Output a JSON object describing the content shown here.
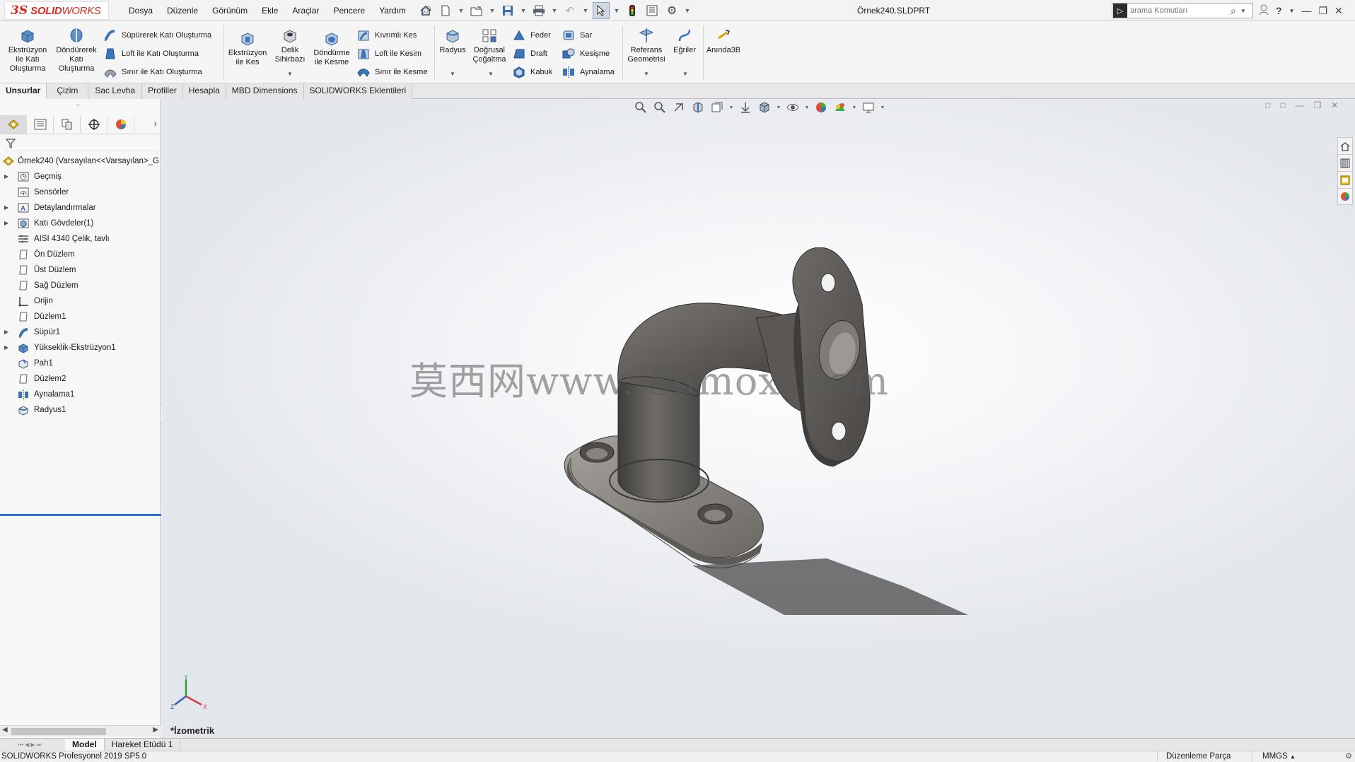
{
  "app": {
    "brand_ds": "3S",
    "brand_solid": "SOLID",
    "brand_works": "WORKS",
    "document_title": "Örnek240.SLDPRT"
  },
  "menu": [
    "Dosya",
    "Düzenle",
    "Görünüm",
    "Ekle",
    "Araçlar",
    "Pencere",
    "Yardım"
  ],
  "search": {
    "placeholder": "arama Komutları"
  },
  "ribbon": {
    "extrude_boss": [
      "Ekstrüzyon",
      "ile Katı",
      "Oluşturma"
    ],
    "revolve_boss": [
      "Döndürerek",
      "Katı",
      "Oluşturma"
    ],
    "sweep_boss": "Süpürerek Katı Oluşturma",
    "loft_boss": "Loft ile Katı Oluşturma",
    "boundary_boss": "Sınır ile Katı Oluşturma",
    "extrude_cut": [
      "Ekstrüzyon",
      "ile Kes"
    ],
    "hole_wizard": [
      "Delik",
      "Sihirbazı"
    ],
    "revolve_cut": [
      "Döndürme",
      "ile Kesme"
    ],
    "swept_cut": "Kıvrımlı Kes",
    "loft_cut": "Loft ile Kesim",
    "boundary_cut": "Sınır ile Kesme",
    "fillet": "Radyus",
    "linear_pattern": [
      "Doğrusal",
      "Çoğaltma"
    ],
    "rib": "Feder",
    "draft": "Draft",
    "shell": "Kabuk",
    "wrap": "Sar",
    "intersect": "Kesişme",
    "mirror": "Aynalama",
    "ref_geometry": [
      "Referans",
      "Geometrisi"
    ],
    "curves": "Eğriler",
    "instant3d": "Anında3B"
  },
  "tabs": [
    {
      "label": "Unsurlar",
      "active": true
    },
    {
      "label": "Çizim",
      "active": false
    },
    {
      "label": "Sac Levha",
      "active": false
    },
    {
      "label": "Profiller",
      "active": false
    },
    {
      "label": "Hesapla",
      "active": false
    },
    {
      "label": "MBD Dimensions",
      "active": false
    },
    {
      "label": "SOLIDWORKS Eklentileri",
      "active": false
    }
  ],
  "tree": {
    "root": "Örnek240  (Varsayılan<<Varsayılan>_G",
    "items": [
      {
        "label": "Geçmiş",
        "expandable": true,
        "icon": "history-icon"
      },
      {
        "label": "Sensörler",
        "expandable": false,
        "icon": "sensor-icon"
      },
      {
        "label": "Detaylandırmalar",
        "expandable": true,
        "icon": "annotation-icon"
      },
      {
        "label": "Katı Gövdeler(1)",
        "expandable": true,
        "icon": "solid-bodies-icon"
      },
      {
        "label": "AISI 4340 Çelik, tavlı",
        "expandable": false,
        "icon": "material-icon"
      },
      {
        "label": "Ön Düzlem",
        "expandable": false,
        "icon": "plane-icon"
      },
      {
        "label": "Üst Düzlem",
        "expandable": false,
        "icon": "plane-icon"
      },
      {
        "label": "Sağ Düzlem",
        "expandable": false,
        "icon": "plane-icon"
      },
      {
        "label": "Orijin",
        "expandable": false,
        "icon": "origin-icon"
      },
      {
        "label": "Düzlem1",
        "expandable": false,
        "icon": "plane-icon"
      },
      {
        "label": "Süpür1",
        "expandable": true,
        "icon": "sweep-icon"
      },
      {
        "label": "Yükseklik-Ekstrüzyon1",
        "expandable": true,
        "icon": "extrude-icon"
      },
      {
        "label": "Pah1",
        "expandable": false,
        "icon": "chamfer-icon"
      },
      {
        "label": "Düzlem2",
        "expandable": false,
        "icon": "plane-icon"
      },
      {
        "label": "Aynalama1",
        "expandable": false,
        "icon": "mirror-icon"
      },
      {
        "label": "Radyus1",
        "expandable": false,
        "icon": "fillet-icon"
      }
    ]
  },
  "viewport": {
    "view_name": "*İzometrik",
    "watermark": "莫西网www. 3dmox. com",
    "triad_x": "X",
    "triad_y": "Y",
    "triad_z": "Z"
  },
  "bottom_tabs": [
    {
      "label": "Model",
      "active": true
    },
    {
      "label": "Hareket Etüdü 1",
      "active": false
    }
  ],
  "status": {
    "product": "SOLIDWORKS Profesyonel 2019 SP5.0",
    "mode": "Düzenleme Parça",
    "units": "MMGS"
  },
  "colors": {
    "brand_red": "#d52b1e",
    "selection_blue": "#2f74c9",
    "model_gray": "#6f6d6b"
  }
}
